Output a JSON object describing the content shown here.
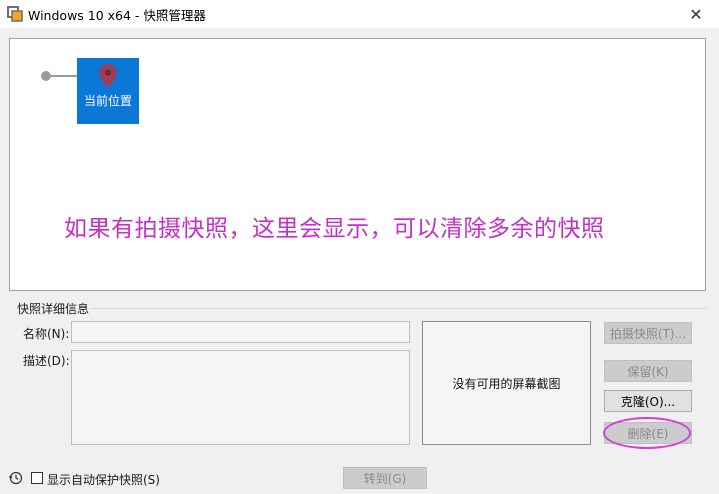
{
  "window": {
    "title": "Windows 10 x64 - 快照管理器",
    "close_glyph": "✕"
  },
  "tree": {
    "current_node_label": "当前位置"
  },
  "annotation_text": "如果有拍摄快照，这里会显示，可以清除多余的快照",
  "details": {
    "group_title": "快照详细信息",
    "name_label": "名称(N):",
    "name_value": "",
    "desc_label": "描述(D):",
    "desc_value": "",
    "no_screenshot_text": "没有可用的屏幕截图"
  },
  "buttons": {
    "take_snapshot": "拍摄快照(T)...",
    "keep": "保留(K)",
    "clone": "克隆(O)...",
    "delete": "删除(E)",
    "goto": "转到(G)"
  },
  "footer": {
    "auto_protect_label": "显示自动保护快照(S)",
    "auto_protect_checked": false
  },
  "colors": {
    "node_blue": "#0a78d7",
    "annotation_magenta": "#c431c8",
    "highlight_circle": "#d33fd7"
  }
}
